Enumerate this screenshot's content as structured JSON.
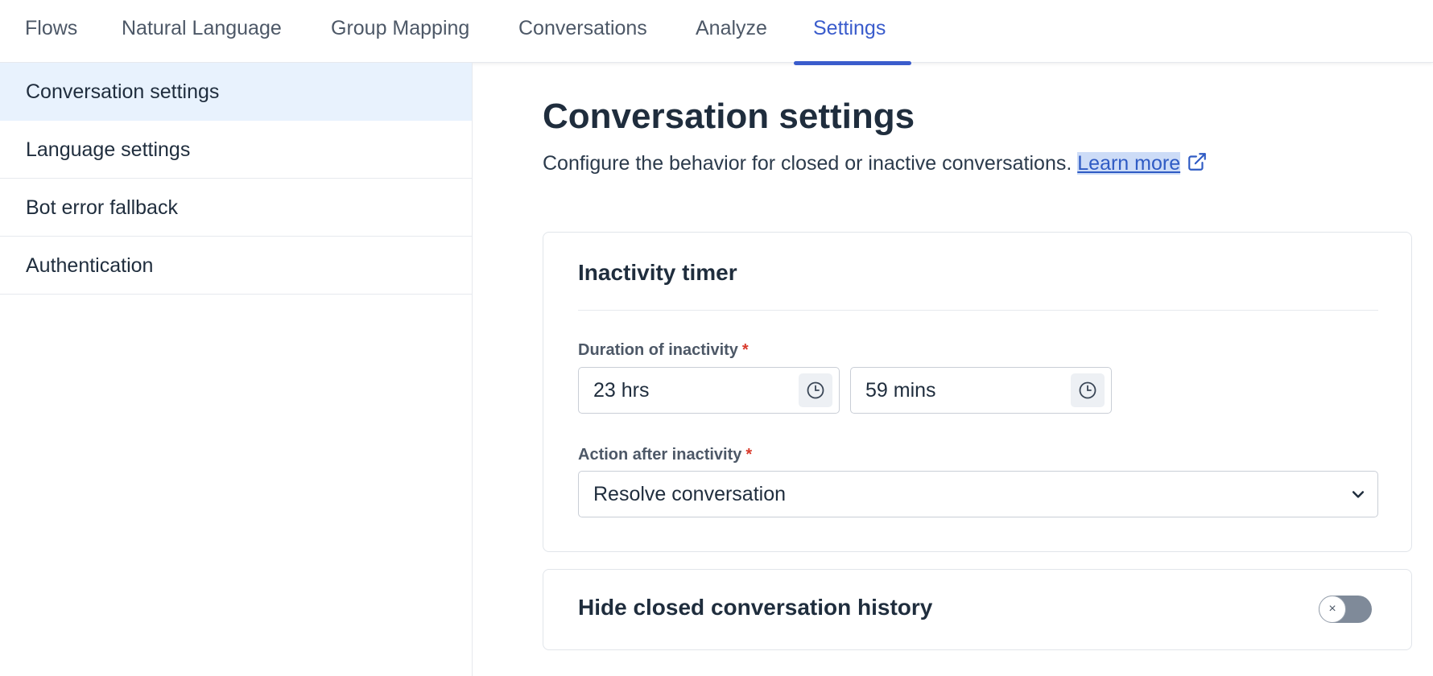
{
  "nav": {
    "tabs": [
      {
        "label": "Flows"
      },
      {
        "label": "Natural Language"
      },
      {
        "label": "Group Mapping"
      },
      {
        "label": "Conversations"
      },
      {
        "label": "Analyze"
      },
      {
        "label": "Settings"
      }
    ],
    "active_tab": "Settings"
  },
  "sidebar": {
    "items": [
      {
        "label": "Conversation settings"
      },
      {
        "label": "Language settings"
      },
      {
        "label": "Bot error fallback"
      },
      {
        "label": "Authentication"
      }
    ],
    "active_item": "Conversation settings"
  },
  "main": {
    "title": "Conversation settings",
    "description": "Configure the behavior for closed or inactive conversations.",
    "learn_more": "Learn more",
    "inactivity_card": {
      "title": "Inactivity timer",
      "duration_label": "Duration of inactivity",
      "required_mark": "*",
      "hours_value": "23 hrs",
      "minutes_value": "59 mins",
      "action_label": "Action after inactivity",
      "action_value": "Resolve conversation"
    },
    "history_card": {
      "title": "Hide closed conversation history",
      "toggle_on": false,
      "toggle_glyph": "×"
    }
  },
  "colors": {
    "accent": "#3a5ccc",
    "active_sidebar_bg": "#e8f2fd",
    "required": "#d93a2b",
    "toggle_off": "#7f8a99"
  }
}
